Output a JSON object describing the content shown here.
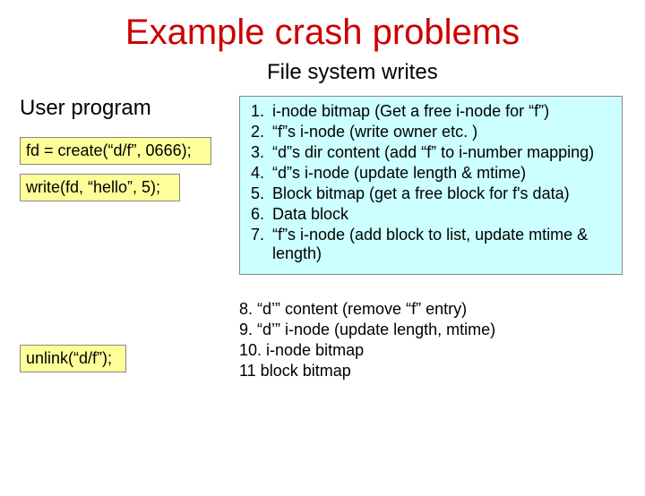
{
  "title": "Example crash problems",
  "subtitle": "File system writes",
  "left": {
    "heading": "User program",
    "code1": "fd = create(“d/f”, 0666);",
    "code2": "write(fd, “hello”, 5);",
    "code3": "unlink(“d/f”);"
  },
  "steps": {
    "s1": "i-node bitmap (Get a free i-node for “f”)",
    "s2": "“f”s i-node (write owner etc. )",
    "s3": "“d”s dir content (add “f” to i-number mapping)",
    "s4": "“d”s i-node (update length & mtime)",
    "s5": "Block bitmap (get a free block for f's data)",
    "s6": "Data block",
    "s7": "“f”s i-node (add block to list, update mtime & length)"
  },
  "lower": {
    "l8": "8. “d’” content (remove “f” entry)",
    "l9": "9. “d’” i-node (update length, mtime)",
    "l10": "10. i-node bitmap",
    "l11": "11 block bitmap"
  }
}
